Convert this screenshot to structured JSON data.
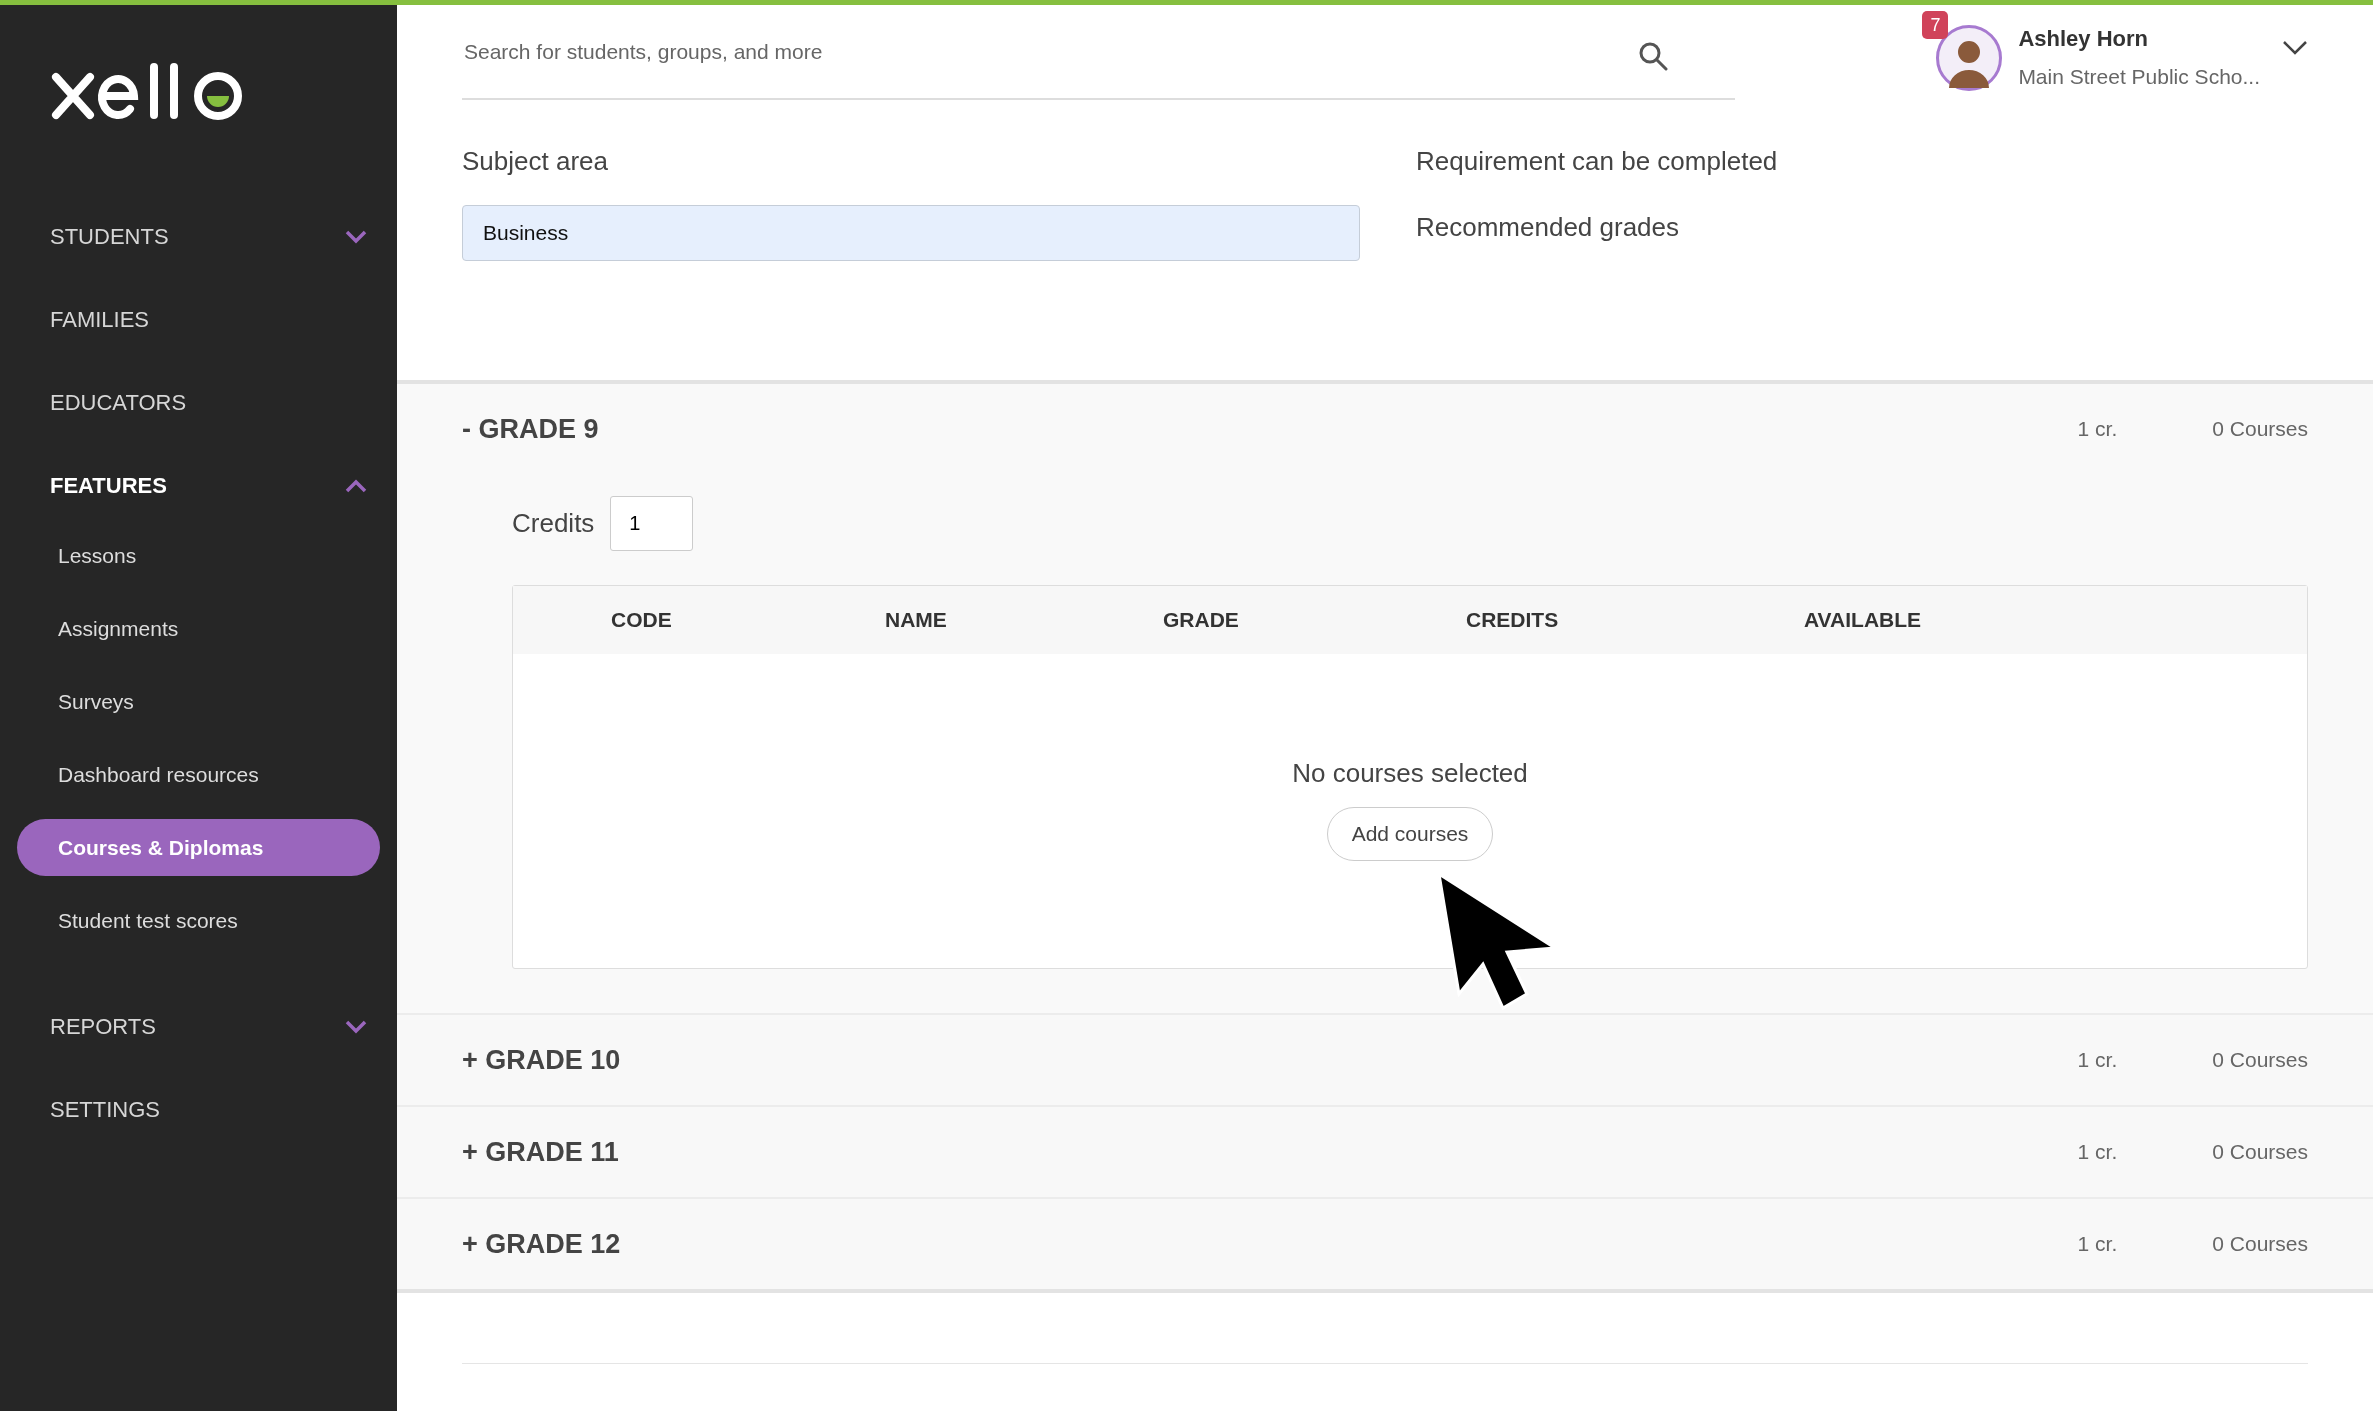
{
  "search": {
    "placeholder": "Search for students, groups, and more"
  },
  "user": {
    "name": "Ashley Horn",
    "school": "Main Street Public Scho...",
    "notifications": "7"
  },
  "sidebar": {
    "items": [
      {
        "label": "STUDENTS",
        "kind": "group",
        "expanded": false
      },
      {
        "label": "FAMILIES",
        "kind": "link"
      },
      {
        "label": "EDUCATORS",
        "kind": "link"
      },
      {
        "label": "FEATURES",
        "kind": "group",
        "expanded": true,
        "children": [
          {
            "label": "Lessons",
            "selected": false
          },
          {
            "label": "Assignments",
            "selected": false
          },
          {
            "label": "Surveys",
            "selected": false
          },
          {
            "label": "Dashboard resources",
            "selected": false
          },
          {
            "label": "Courses & Diplomas",
            "selected": true
          },
          {
            "label": "Student test scores",
            "selected": false
          }
        ]
      },
      {
        "label": "REPORTS",
        "kind": "group",
        "expanded": false
      },
      {
        "label": "SETTINGS",
        "kind": "link"
      }
    ]
  },
  "form": {
    "subject_label": "Subject area",
    "subject_value": "Business",
    "requirement_label": "Requirement can be completed",
    "grades_label": "Recommended grades"
  },
  "grades": [
    {
      "toggle": "-",
      "title": "GRADE 9",
      "expanded": true,
      "credits": "1 cr.",
      "courses": "0 Courses",
      "credits_label": "Credits",
      "credits_value": "1",
      "columns": [
        "CODE",
        "NAME",
        "GRADE",
        "CREDITS",
        "AVAILABLE"
      ],
      "empty_message": "No courses selected",
      "add_button": "Add courses"
    },
    {
      "toggle": "+",
      "title": "GRADE 10",
      "expanded": false,
      "credits": "1 cr.",
      "courses": "0 Courses"
    },
    {
      "toggle": "+",
      "title": "GRADE 11",
      "expanded": false,
      "credits": "1 cr.",
      "courses": "0 Courses"
    },
    {
      "toggle": "+",
      "title": "GRADE 12",
      "expanded": false,
      "credits": "1 cr.",
      "courses": "0 Courses"
    }
  ]
}
